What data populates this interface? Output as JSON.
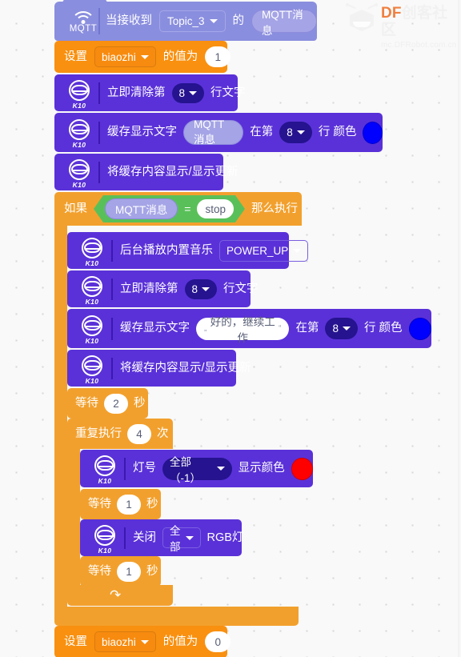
{
  "watermark": {
    "brand_prefix": "DF",
    "brand_suffix": "创客社区",
    "url": "mc.DFRobot.com.cn"
  },
  "colors": {
    "event_block": "#8a8ede",
    "variable_block": "#f9900f",
    "control_block": "#f2a02d",
    "operator_block": "#59c059",
    "device_block": "#5a31d8",
    "color_blue": "#0000FF",
    "color_red": "#FF0000",
    "canvas_bg": "#f9f9f9"
  },
  "script": {
    "hat": {
      "icon": "mqtt-wifi-icon",
      "icon_label": "MQTT",
      "text_1": "当接收到",
      "topic_value": "Topic_3",
      "text_2": "的",
      "message_reporter": "MQTT消息"
    },
    "blocks": [
      {
        "id": "set-biaozhi-1",
        "kind": "variable-set",
        "text_1": "设置",
        "variable": "biaozhi",
        "text_2": "的值为",
        "value": "1"
      },
      {
        "id": "clear-line-1",
        "kind": "device",
        "device": "K10",
        "text_1": "立即清除第",
        "line": "8",
        "text_2": "行文字"
      },
      {
        "id": "buffer-text-1",
        "kind": "device",
        "device": "K10",
        "text_1": "缓存显示文字",
        "content_kind": "reporter",
        "content": "MQTT消息",
        "text_2": "在第",
        "line": "8",
        "text_3": "行 颜色",
        "color": "#0000FF"
      },
      {
        "id": "refresh-1",
        "kind": "device",
        "device": "K10",
        "text_1": "将缓存内容显示/显示更新"
      }
    ],
    "if_block": {
      "text_if": "如果",
      "text_then": "那么执行",
      "condition": {
        "operator": "=",
        "left_reporter": "MQTT消息",
        "right_value": "stop"
      },
      "body": [
        {
          "id": "play-music",
          "kind": "device",
          "device": "K10",
          "text_1": "后台播放内置音乐",
          "music": "POWER_UP"
        },
        {
          "id": "clear-line-2",
          "kind": "device",
          "device": "K10",
          "text_1": "立即清除第",
          "line": "8",
          "text_2": "行文字"
        },
        {
          "id": "buffer-text-2",
          "kind": "device",
          "device": "K10",
          "text_1": "缓存显示文字",
          "content_kind": "text",
          "content": "好的，继续工作",
          "text_2": "在第",
          "line": "8",
          "text_3": "行 颜色",
          "color": "#0000FF"
        },
        {
          "id": "refresh-2",
          "kind": "device",
          "device": "K10",
          "text_1": "将缓存内容显示/显示更新"
        },
        {
          "id": "wait-2",
          "kind": "control-wait",
          "text_1": "等待",
          "value": "2",
          "text_2": "秒"
        }
      ],
      "repeat": {
        "text_1": "重复执行",
        "value": "4",
        "text_2": "次",
        "body": [
          {
            "id": "rgb-color",
            "kind": "device",
            "device": "K10",
            "text_1": "灯号",
            "lamp": "全部（-1）",
            "text_2": "显示颜色",
            "color": "#FF0000"
          },
          {
            "id": "wait-1a",
            "kind": "control-wait",
            "text_1": "等待",
            "value": "1",
            "text_2": "秒"
          },
          {
            "id": "rgb-off",
            "kind": "device",
            "device": "K10",
            "text_1": "关闭",
            "lamp": "全部",
            "text_2": "RGB灯"
          },
          {
            "id": "wait-1b",
            "kind": "control-wait",
            "text_1": "等待",
            "value": "1",
            "text_2": "秒"
          }
        ]
      }
    },
    "tail": {
      "id": "set-biaozhi-0",
      "kind": "variable-set",
      "text_1": "设置",
      "variable": "biaozhi",
      "text_2": "的值为",
      "value": "0"
    }
  }
}
